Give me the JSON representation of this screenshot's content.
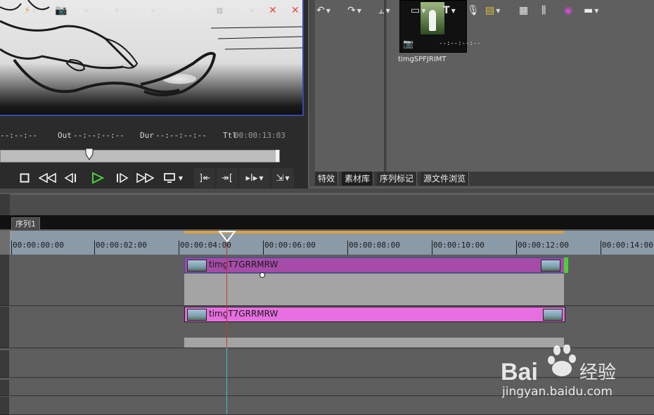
{
  "player": {
    "in_label": "",
    "in_value": "--:--:--",
    "out_label": "Out",
    "out_value": "--:--:--:--",
    "dur_label": "Dur",
    "dur_value": "--:--:--:--",
    "ttl_label": "Ttl",
    "ttl_value": "00:00:13:03",
    "scrub_position": 0.32
  },
  "library": {
    "thumbnail": {
      "name": "timgSPFJRIMT",
      "timecode": "--:--:--:--"
    },
    "tabs": [
      "特效",
      "素材库",
      "序列标记",
      "源文件浏览"
    ],
    "active_tab": 1
  },
  "sequence": {
    "tab_label": "序列1"
  },
  "ruler": {
    "labels": [
      "00:00:00:00",
      "00:00:02:00",
      "00:00:04:00",
      "00:00:06:00",
      "00:00:08:00",
      "00:00:10:00",
      "00:00:12:00",
      "00:00:14:00"
    ],
    "cursor": "00:00:04:00"
  },
  "tracks": {
    "video_clip": {
      "name": "timgT7GRRMRW",
      "color": "#a64ca8"
    },
    "audio_clip": {
      "name": "timgT7GRRMRW",
      "color": "#e76ee0"
    }
  },
  "watermark": {
    "brand": "Bai",
    "brand2": "经验",
    "url": "jingyan.baidu.com"
  },
  "colors": {
    "accent_green": "#4cd03a",
    "selection_border": "#3b4aa8"
  }
}
